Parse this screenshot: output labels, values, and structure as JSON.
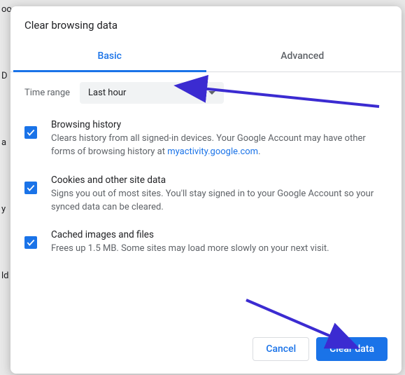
{
  "dialog": {
    "title": "Clear browsing data",
    "tabs": {
      "basic": "Basic",
      "advanced": "Advanced"
    },
    "timeRange": {
      "label": "Time range",
      "value": "Last hour"
    },
    "items": [
      {
        "title": "Browsing history",
        "desc_pre": "Clears history from all signed-in devices. Your Google Account may have other forms of browsing history at ",
        "desc_link": "myactivity.google.com",
        "desc_post": "."
      },
      {
        "title": "Cookies and other site data",
        "desc": "Signs you out of most sites. You'll stay signed in to your Google Account so your synced data can be cleared."
      },
      {
        "title": "Cached images and files",
        "desc": "Frees up 1.5 MB. Some sites may load more slowly on your next visit."
      }
    ],
    "actions": {
      "cancel": "Cancel",
      "confirm": "Clear data"
    }
  },
  "backdrop": [
    "oo",
    "D",
    "a",
    "y",
    "ld"
  ],
  "colors": {
    "accent": "#1a73e8",
    "arrow": "#3b2bd1"
  }
}
